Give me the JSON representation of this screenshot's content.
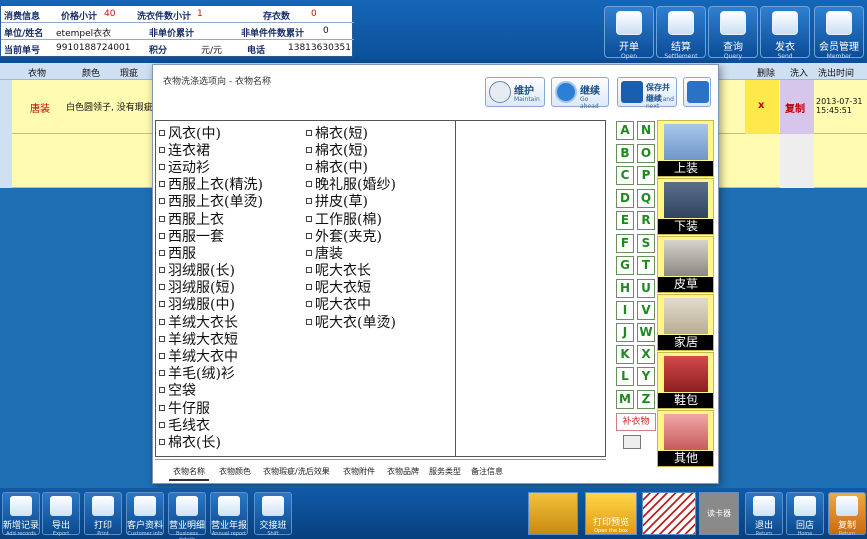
{
  "info_panel": {
    "row1": {
      "label": "消费信息",
      "f1_label": "价格小计",
      "f1_value": "40",
      "f2_label": "洗衣件数小计",
      "f2_value": "1",
      "f3_label": "存衣数",
      "f3_value": "0"
    },
    "row2": {
      "label": "单位/姓名",
      "f1_value": "etempel衣衣",
      "f2_label": "非单价累计",
      "f3_label": "非单件件数累计",
      "f3_value": "0"
    },
    "row3": {
      "label": "当前单号",
      "f1_value": "9910188724001",
      "f2_label": "积分",
      "f2_value": "元/元",
      "f3_label": "电话",
      "f3_value": "13813630351"
    }
  },
  "top_buttons": [
    {
      "label": "开单",
      "sub": "Open"
    },
    {
      "label": "结算",
      "sub": "Settlement"
    },
    {
      "label": "查询",
      "sub": "Query"
    },
    {
      "label": "发衣",
      "sub": "Send"
    },
    {
      "label": "会员管理",
      "sub": "Member"
    }
  ],
  "bg_table": {
    "headers": [
      "衣物",
      "颜色",
      "瑕疵",
      "洗衣方式",
      "附件",
      "品牌",
      "价格",
      "折扣",
      "退衣",
      "删除",
      "洗入",
      "洗出时间"
    ],
    "row": {
      "item": "唐装",
      "desc": "白色圆领子, 没有瑕疵",
      "delete": "x",
      "copy": "复制",
      "time": "2013-07-31 15:45:51"
    }
  },
  "modal": {
    "title": "衣物洗涤选项向 - 衣物名称",
    "buttons": [
      {
        "label": "维护",
        "sub": "Maintain"
      },
      {
        "label": "继续",
        "sub": "Go ahead"
      },
      {
        "label": "保存并继续",
        "sub": "Save and next"
      },
      {
        "label": "",
        "sub": "Back"
      }
    ],
    "column1": [
      "风衣(中)",
      "连衣裙",
      "运动衫",
      "西服上衣(精洗)",
      "西服上衣(单烫)",
      "西服上衣",
      "西服一套",
      "西服",
      "羽绒服(长)",
      "羽绒服(短)",
      "羽绒服(中)",
      "羊绒大衣长",
      "羊绒大衣短",
      "羊绒大衣中",
      "羊毛(绒)衫",
      "空袋",
      "牛仔服",
      "毛线衣",
      "棉衣(长)"
    ],
    "column2": [
      "棉衣(短)",
      "棉衣(短)",
      "棉衣(中)",
      "晚礼服(婚纱)",
      "拼皮(草)",
      "工作服(棉)",
      "外套(夹克)",
      "唐装",
      "呢大衣长",
      "呢大衣短",
      "呢大衣中",
      "呢大衣(单烫)"
    ],
    "letters": [
      "A",
      "N",
      "B",
      "O",
      "C",
      "P",
      "D",
      "Q",
      "E",
      "R",
      "F",
      "S",
      "G",
      "T",
      "H",
      "U",
      "I",
      "V",
      "J",
      "W",
      "K",
      "X",
      "L",
      "Y",
      "M",
      "Z"
    ],
    "all_button": "补衣物",
    "categories": [
      "上装",
      "下装",
      "皮草",
      "家居",
      "鞋包",
      "其他"
    ],
    "tabs": [
      "衣物名称",
      "衣物颜色",
      "衣物瑕疵/洗后效果",
      "衣物附件",
      "衣物品牌",
      "服务类型",
      "备注信息"
    ]
  },
  "bottom_buttons": [
    {
      "label": "新增记录",
      "sub": "Add records"
    },
    {
      "label": "导出",
      "sub": "Export"
    },
    {
      "label": "打印",
      "sub": "Print"
    },
    {
      "label": "客户资料",
      "sub": "Customer info"
    },
    {
      "label": "营业明细",
      "sub": "Business details"
    },
    {
      "label": "营业年报",
      "sub": "Annual report"
    },
    {
      "label": "交接班",
      "sub": "Shift"
    }
  ],
  "bottom_right": {
    "promo_label": "打印预览",
    "promo_sub": "Open the box",
    "gray_label": "读卡器",
    "back_label": "退出",
    "back_sub": "Return",
    "home_label": "回店",
    "home_sub": "Home",
    "reset_label": "复制",
    "reset_sub": "Return"
  },
  "colors": {
    "accent": "#1f6fb4",
    "highlight_yellow": "#fff58a",
    "letter_green": "#1e8a1e",
    "red": "#d01010"
  }
}
